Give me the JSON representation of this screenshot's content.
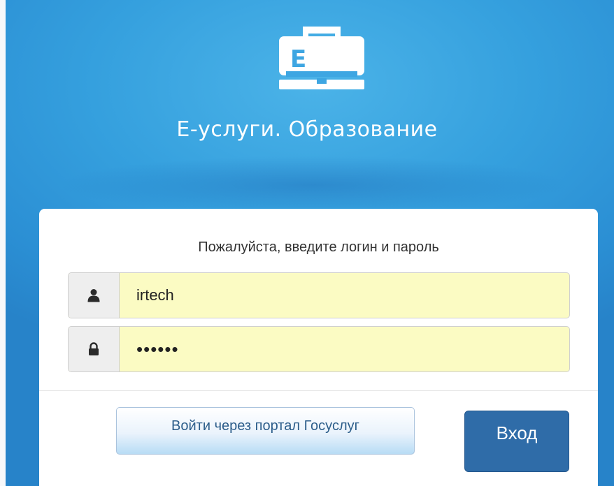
{
  "app": {
    "title": "Е-услуги. Образование",
    "logo_letter": "E",
    "logo_icon": "briefcase-icon"
  },
  "login_form": {
    "prompt": "Пожалуйста, введите логин и пароль",
    "username": {
      "icon": "user-icon",
      "value": "irtech"
    },
    "password": {
      "icon": "lock-icon",
      "value": "irtech"
    },
    "gosuslugi_button_label": "Войти через портал Госуслуг",
    "submit_button_label": "Вход"
  },
  "colors": {
    "background_blue": "#35a0de",
    "login_field_autofill": "#fbfbc3",
    "submit_button": "#2f6ca8",
    "gosuslugi_button_text": "#2c5d8a"
  }
}
